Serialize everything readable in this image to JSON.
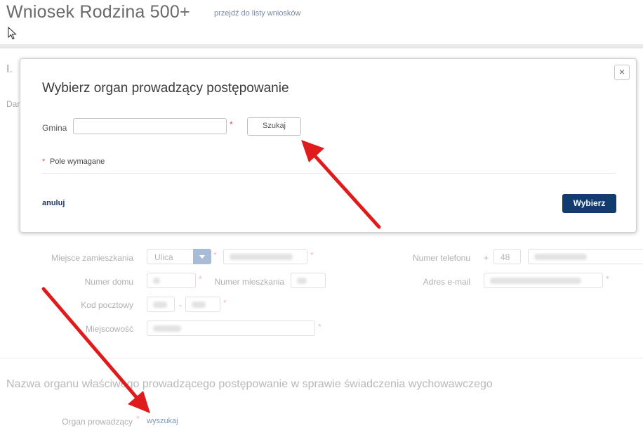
{
  "header": {
    "title": "Wniosek Rodzina 500+",
    "back_link": "przejdź do listy wniosków"
  },
  "page": {
    "section_number": "I.",
    "partial_text": "Dan"
  },
  "modal": {
    "title": "Wybierz organ prowadzący postępowanie",
    "close_label": "×",
    "gmina_label": "Gmina",
    "gmina_value": "",
    "required_marker": "*",
    "search_button": "Szukaj",
    "required_note": "Pole wymagane",
    "cancel_link": "anuluj",
    "select_button": "Wybierz"
  },
  "address_form": {
    "residence_label": "Miejsce zamieszkania",
    "street_type_value": "Ulica",
    "house_number_label": "Numer domu",
    "apartment_number_label": "Numer mieszkania",
    "postal_code_label": "Kod pocztowy",
    "postal_separator": "-",
    "city_label": "Miejscowość",
    "phone_label": "Numer telefonu",
    "phone_plus": "+",
    "phone_prefix_value": "48",
    "email_label": "Adres e-mail"
  },
  "authority_section": {
    "heading": "Nazwa organu właściwego prowadzącego postępowanie w sprawie świadczenia wychowawczego",
    "authority_label": "Organ prowadzący",
    "search_link": "wyszukaj"
  },
  "colors": {
    "primary_button": "#123b70",
    "required_star": "#d9534f",
    "arrow": "#e01b1b"
  }
}
